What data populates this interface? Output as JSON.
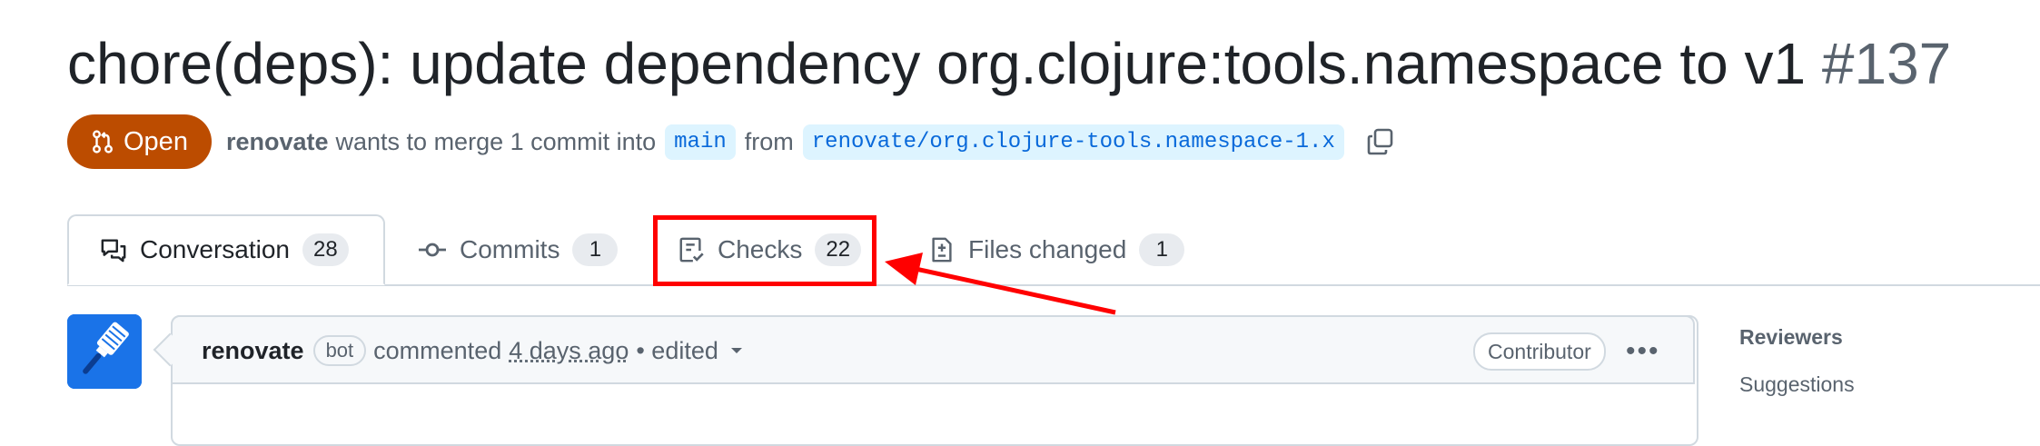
{
  "pr": {
    "title": "chore(deps): update dependency org.clojure:tools.namespace to v1",
    "number": "#137",
    "state": "Open",
    "author": "renovate",
    "merge_text": "wants to merge 1 commit into",
    "base_branch": "main",
    "from_text": "from",
    "head_branch": "renovate/org.clojure-tools.namespace-1.x"
  },
  "tabs": [
    {
      "label": "Conversation",
      "count": "28"
    },
    {
      "label": "Commits",
      "count": "1"
    },
    {
      "label": "Checks",
      "count": "22"
    },
    {
      "label": "Files changed",
      "count": "1"
    }
  ],
  "comment": {
    "author": "renovate",
    "bot_label": "bot",
    "action": "commented",
    "time": "4 days ago",
    "edited": "• edited",
    "role": "Contributor"
  },
  "sidebar": {
    "reviewers_title": "Reviewers",
    "reviewers_sub": "Suggestions"
  },
  "colors": {
    "open_state": "#bc4c00",
    "annotation": "#ff0000",
    "link": "#0969da"
  }
}
